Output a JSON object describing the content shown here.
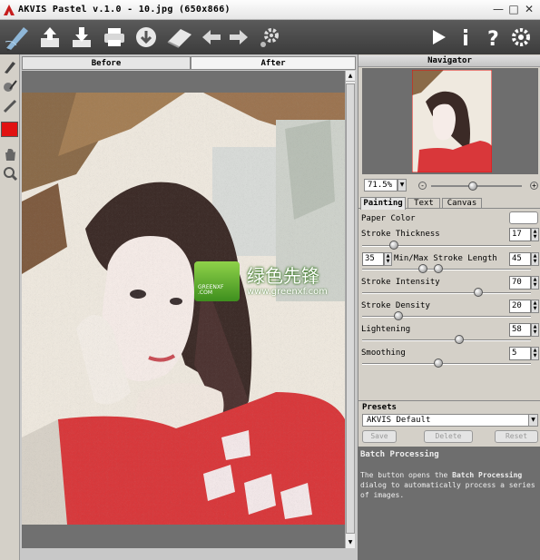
{
  "window": {
    "title": "AKVIS Pastel v.1.0 - 10.jpg (650x866)"
  },
  "toolbar": {
    "icons": [
      "open-icon",
      "save-icon",
      "print-icon",
      "share-icon",
      "eraser-icon",
      "undo-icon",
      "redo-icon",
      "settings-gear-icon",
      "run-icon",
      "info-icon",
      "help-icon",
      "preferences-icon"
    ]
  },
  "tabs": {
    "before": "Before",
    "after": "After"
  },
  "watermark": {
    "brand": "绿色先锋",
    "url": "www.greenxf.com",
    "badge": "GREENXF\n.COM"
  },
  "navigator": {
    "title": "Navigator",
    "zoom": "71.5%"
  },
  "settings_tabs": {
    "painting": "Painting",
    "text": "Text",
    "canvas": "Canvas"
  },
  "params": {
    "paper_color": {
      "label": "Paper Color",
      "color": "#ffffff"
    },
    "stroke_thickness": {
      "label": "Stroke Thickness",
      "value": "17",
      "level": 0.17
    },
    "stroke_length": {
      "label": "Min/Max Stroke Length",
      "min": "35",
      "max": "45",
      "min_level": 0.35,
      "max_level": 0.45
    },
    "stroke_intensity": {
      "label": "Stroke Intensity",
      "value": "70",
      "level": 0.7
    },
    "stroke_density": {
      "label": "Stroke Density",
      "value": "20",
      "level": 0.2
    },
    "lightening": {
      "label": "Lightening",
      "value": "58",
      "level": 0.58
    },
    "smoothing": {
      "label": "Smoothing",
      "value": "5",
      "level": 0.45
    }
  },
  "presets": {
    "title": "Presets",
    "selected": "AKVIS Default",
    "save": "Save",
    "delete": "Delete",
    "reset": "Reset"
  },
  "help": {
    "title": "Batch Processing",
    "text_before": "The button opens the ",
    "text_bold": "Batch Processing",
    "text_after": " dialog to automatically process a series of images."
  },
  "colors": {
    "accent_red": "#e11212",
    "toolbar_bg": "#4a4a4a"
  }
}
